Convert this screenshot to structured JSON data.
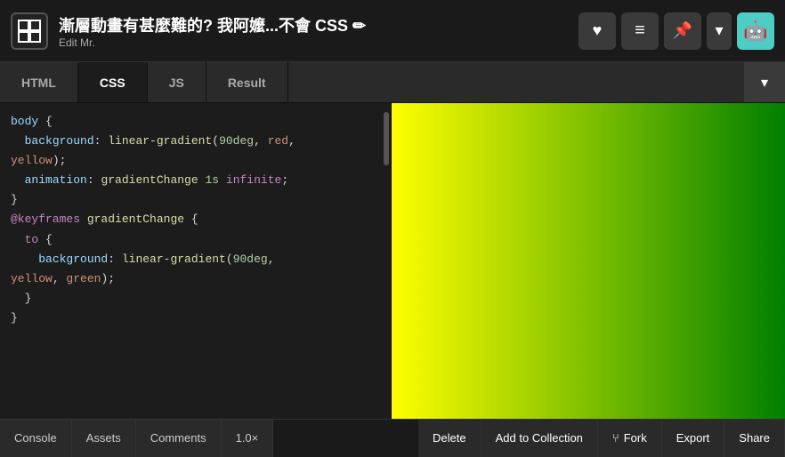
{
  "header": {
    "title": "漸層動畫有甚麼難的? 我阿嬤...不會 CSS ✏",
    "subtitle": "Edit Mr.",
    "logo_symbol": "⊞"
  },
  "header_buttons": {
    "heart_label": "♥",
    "list_label": "≡",
    "pin_label": "📌",
    "chevron_label": "▾",
    "avatar_label": "🤖"
  },
  "tabs": [
    {
      "id": "html",
      "label": "HTML",
      "active": false
    },
    {
      "id": "css",
      "label": "CSS",
      "active": true
    },
    {
      "id": "js",
      "label": "JS",
      "active": false
    },
    {
      "id": "result",
      "label": "Result",
      "active": false
    }
  ],
  "tab_dropdown_label": "▾",
  "code_lines": [
    {
      "text": "body {",
      "type": "plain"
    },
    {
      "text": "  background: linear-gradient(90deg, red,",
      "type": "mixed"
    },
    {
      "text": "yellow);",
      "type": "plain"
    },
    {
      "text": "  animation: gradientChange 1s infinite;",
      "type": "mixed"
    },
    {
      "text": "}",
      "type": "plain"
    },
    {
      "text": "",
      "type": "plain"
    },
    {
      "text": "@keyframes gradientChange {",
      "type": "mixed"
    },
    {
      "text": "  to {",
      "type": "plain"
    },
    {
      "text": "    background: linear-gradient(90deg,",
      "type": "mixed"
    },
    {
      "text": "yellow, green);",
      "type": "plain"
    },
    {
      "text": "  }",
      "type": "plain"
    },
    {
      "text": "}",
      "type": "plain"
    }
  ],
  "bottom_bar": {
    "console": "Console",
    "assets": "Assets",
    "comments": "Comments",
    "zoom": "1.0×",
    "delete": "Delete",
    "add_collection": "Add to Collection",
    "fork_icon": "⑂",
    "fork": "Fork",
    "export": "Export",
    "share": "Share"
  }
}
